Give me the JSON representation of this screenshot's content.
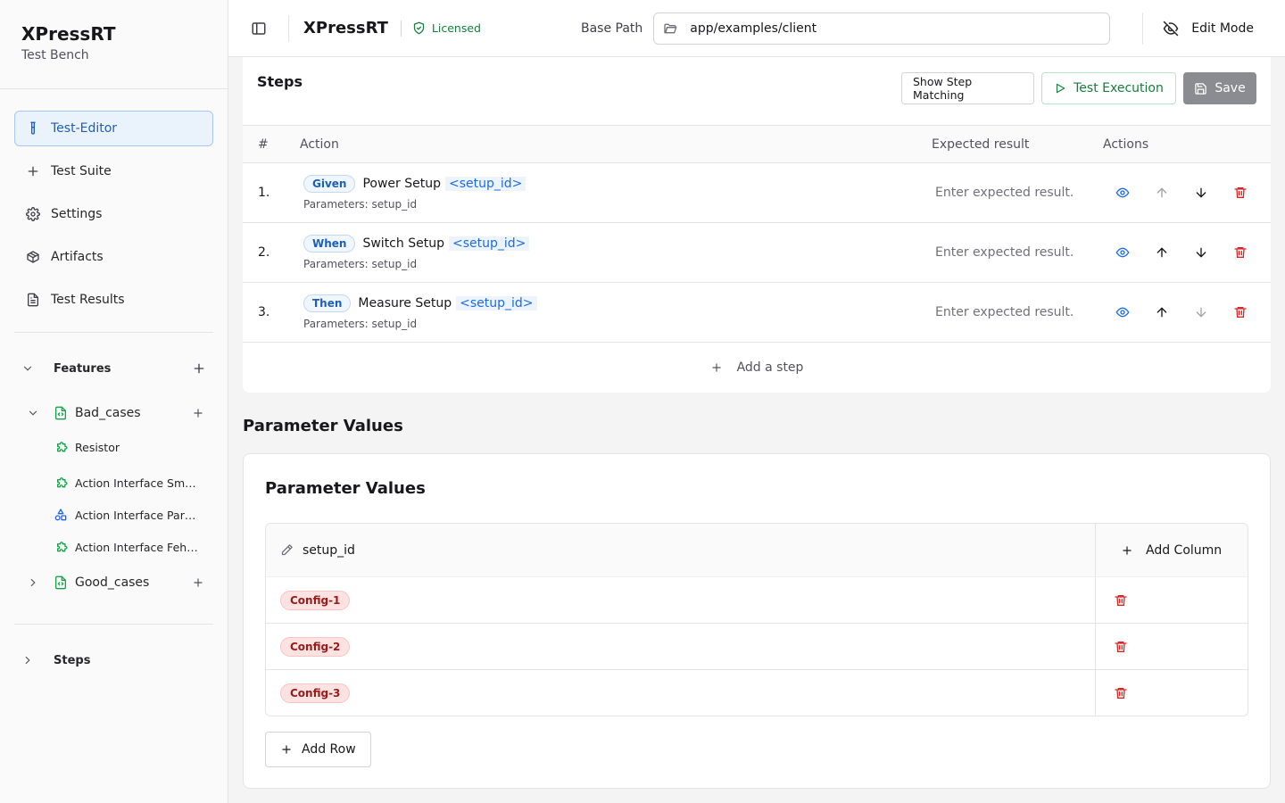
{
  "app": {
    "name": "XPressRT",
    "subtitle": "Test Bench"
  },
  "nav": {
    "items": [
      {
        "label": "Test-Editor",
        "icon": "test-tube-icon",
        "active": true
      },
      {
        "label": "Test Suite",
        "icon": "plus-icon"
      },
      {
        "label": "Settings",
        "icon": "gear-icon"
      },
      {
        "label": "Artifacts",
        "icon": "package-icon"
      },
      {
        "label": "Test Results",
        "icon": "file-text-icon"
      }
    ]
  },
  "features": {
    "label": "Features",
    "folders": [
      {
        "label": "Bad_cases",
        "expanded": true,
        "children": [
          {
            "label": "Resistor",
            "icon": "puzzle-icon"
          },
          {
            "label": "Action Interface Smo...",
            "icon": "puzzle-icon"
          },
          {
            "label": "Action Interface Para...",
            "icon": "shapes-icon"
          },
          {
            "label": "Action Interface Fehl...",
            "icon": "puzzle-icon"
          }
        ]
      },
      {
        "label": "Good_cases",
        "expanded": false,
        "children": []
      }
    ]
  },
  "steps_section": {
    "label": "Steps"
  },
  "topbar": {
    "title": "XPressRT",
    "license": "Licensed",
    "base_path_label": "Base Path",
    "base_path_value": "app/examples/client",
    "edit_mode_label": "Edit Mode"
  },
  "steps": {
    "title": "Steps",
    "show_matching_label": "Show Step Matching",
    "test_execution_label": "Test Execution",
    "save_label": "Save",
    "columns": {
      "num": "#",
      "action": "Action",
      "expected": "Expected result",
      "actions": "Actions"
    },
    "rows": [
      {
        "num": "1.",
        "keyword": "Given",
        "text": "Power Setup",
        "param": "<setup_id>",
        "params_text": "Parameters: setup_id",
        "expected_placeholder": "Enter expected result.",
        "up_enabled": false,
        "down_enabled": true
      },
      {
        "num": "2.",
        "keyword": "When",
        "text": "Switch Setup",
        "param": "<setup_id>",
        "params_text": "Parameters: setup_id",
        "expected_placeholder": "Enter expected result.",
        "up_enabled": true,
        "down_enabled": true
      },
      {
        "num": "3.",
        "keyword": "Then",
        "text": "Measure Setup",
        "param": "<setup_id>",
        "params_text": "Parameters: setup_id",
        "expected_placeholder": "Enter expected result.",
        "up_enabled": true,
        "down_enabled": false
      }
    ],
    "add_step_label": "Add a step"
  },
  "parameter_values": {
    "section_title": "Parameter Values",
    "card_title": "Parameter Values",
    "column": "setup_id",
    "add_column_label": "Add Column",
    "rows": [
      "Config-1",
      "Config-2",
      "Config-3"
    ],
    "add_row_label": "Add Row"
  }
}
